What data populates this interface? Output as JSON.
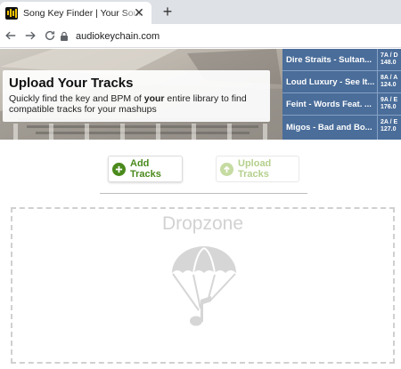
{
  "browser": {
    "tab_title": "Song Key Finder | Your Source for",
    "url": "audiokeychain.com",
    "icons": [
      "back-arrow-icon",
      "forward-arrow-icon",
      "reload-icon",
      "lock-icon",
      "close-icon",
      "plus-icon"
    ]
  },
  "banner": {
    "title": "Upload Your Tracks",
    "text_before": "Quickly find the key and BPM of ",
    "text_bold": "your",
    "text_after": " entire library to find compatible tracks for your mashups"
  },
  "tracks": [
    {
      "name": "Dire Straits - Sultan...",
      "key": "7A / D",
      "bpm": "148.0"
    },
    {
      "name": "Loud Luxury - See It...",
      "key": "8A / A",
      "bpm": "124.0"
    },
    {
      "name": "Feint - Words Feat. ...",
      "key": "9A / E",
      "bpm": "176.0"
    },
    {
      "name": "Migos - Bad and Bo...",
      "key": "2A / E",
      "bpm": "127.0"
    }
  ],
  "buttons": {
    "add_tracks": "Add Tracks",
    "upload_tracks": "Upload Tracks"
  },
  "dropzone": {
    "label": "Dropzone",
    "icon": "parachute-music-note-icon"
  },
  "colors": {
    "track_list_bg": "#4a6d9a",
    "add_button_green": "#4a8a1c",
    "upload_button_disabled": "#b5d08d"
  }
}
